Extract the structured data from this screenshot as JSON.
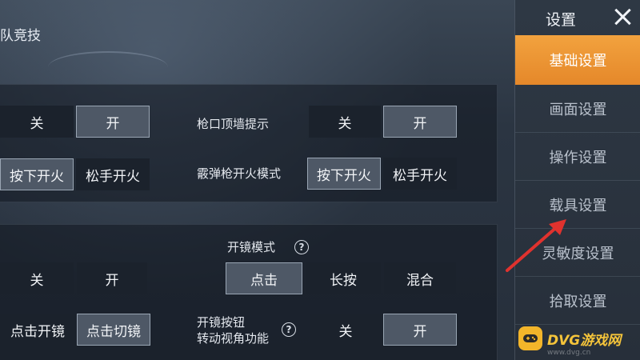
{
  "header": {
    "title": "队竞技"
  },
  "sidebar": {
    "title": "设置",
    "items": [
      {
        "label": "基础设置",
        "active": true
      },
      {
        "label": "画面设置"
      },
      {
        "label": "操作设置"
      },
      {
        "label": "载具设置"
      },
      {
        "label": "灵敏度设置"
      },
      {
        "label": "拾取设置"
      }
    ]
  },
  "panel1": {
    "row1_left": {
      "off": "关",
      "on": "开",
      "selected": "开"
    },
    "row1_right": {
      "label": "枪口顶墙提示",
      "off": "关",
      "on": "开",
      "selected": "开"
    },
    "row2_left": {
      "press": "按下开火",
      "release": "松手开火",
      "selected": "按下开火"
    },
    "row2_right": {
      "label": "霰弹枪开火模式",
      "press": "按下开火",
      "release": "松手开火",
      "selected": "按下开火"
    }
  },
  "panel2": {
    "scope_mode": {
      "label": "开镜模式",
      "tap": "点击",
      "hold": "长按",
      "mix": "混合",
      "selected": "点击"
    },
    "row1_left": {
      "off": "关",
      "on": "开",
      "selected": "关"
    },
    "row2_left": {
      "tap_open": "点击开镜",
      "tap_switch": "点击切镜",
      "selected": "点击切镜"
    },
    "scope_rotate": {
      "label_line1": "开镜按钮",
      "label_line2": "转动视角功能",
      "off": "关",
      "on": "开",
      "selected": "开"
    }
  },
  "watermark": {
    "text": "DVG游戏网",
    "sub": "www.dvg.cn"
  },
  "colors": {
    "accent": "#e8912e",
    "selected_bg": "#4e5866",
    "panel_bg": "#1b222c"
  }
}
